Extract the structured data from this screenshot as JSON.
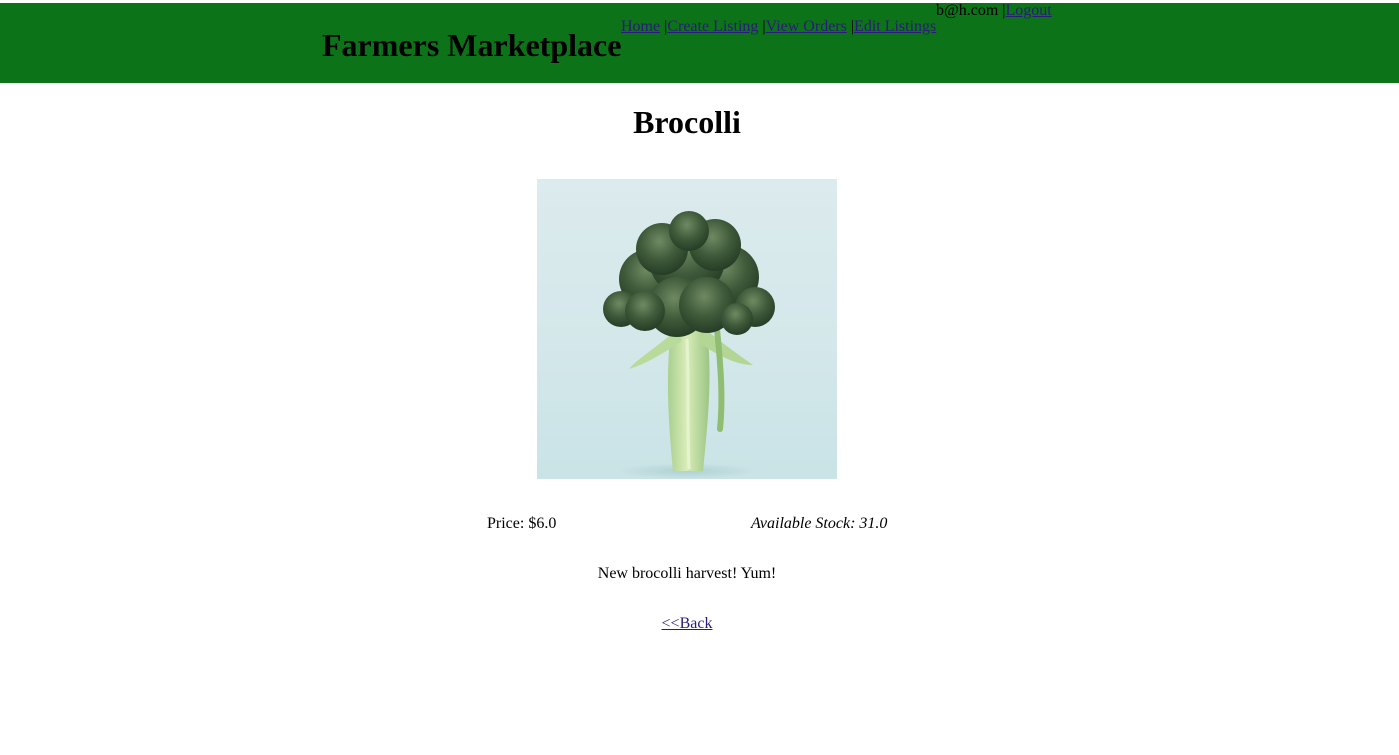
{
  "header": {
    "title": "Farmers Marketplace",
    "nav": [
      {
        "label": "Home"
      },
      {
        "label": "Create Listing"
      },
      {
        "label": "View Orders"
      },
      {
        "label": "Edit Listings"
      }
    ],
    "separator": "|",
    "user_email": "b@h.com",
    "logout_label": "Logout",
    "background_color": "#0c7318"
  },
  "product": {
    "name": "Brocolli",
    "image_subject": "broccoli-photo",
    "price_text": "Price: $6.0",
    "stock_text": "Available Stock: 31.0",
    "description": "New brocolli harvest! Yum!",
    "back_label": "<<Back"
  }
}
